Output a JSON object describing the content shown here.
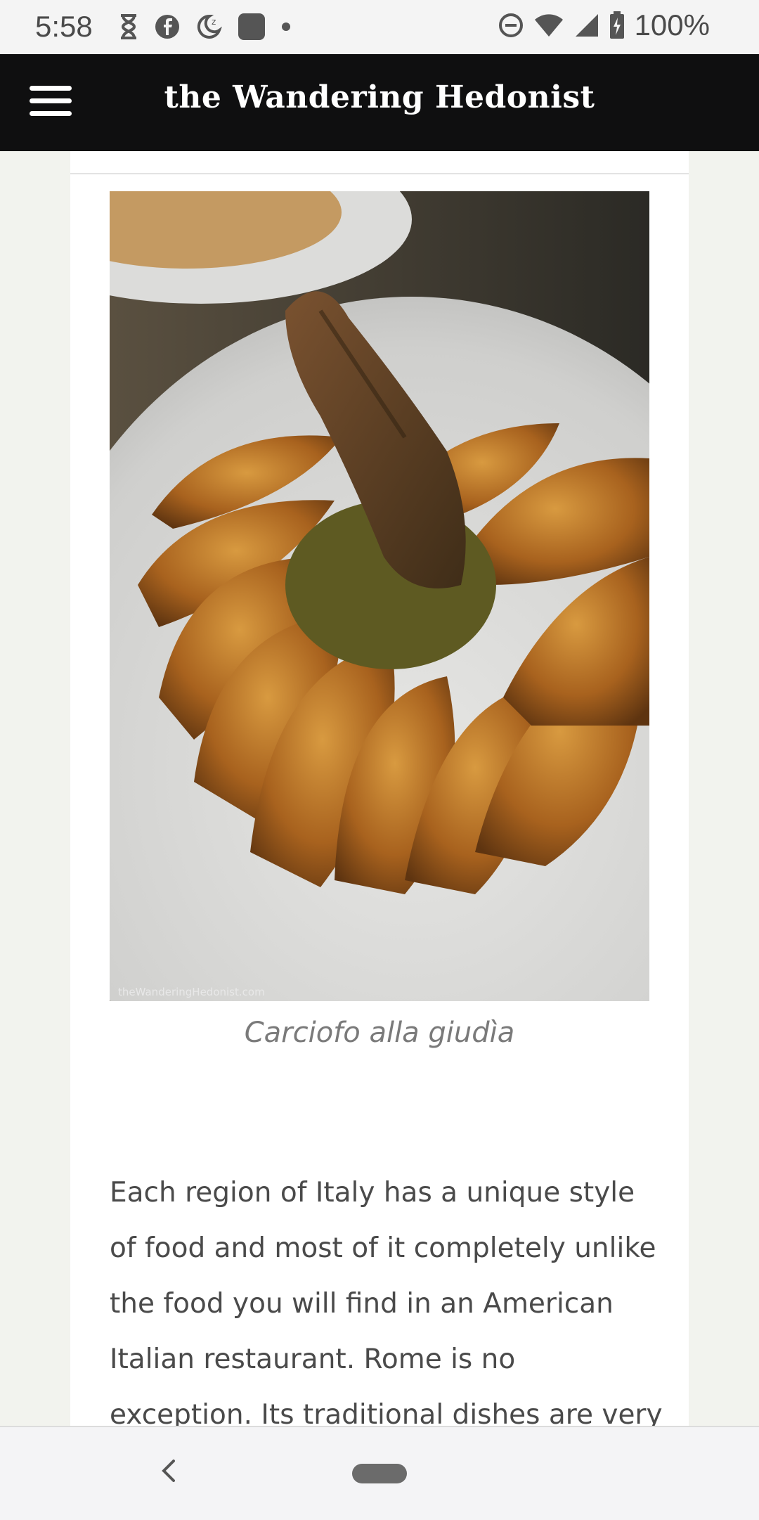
{
  "status_bar": {
    "time": "5:58",
    "battery": "100%",
    "left_icons": [
      "hourglass-icon",
      "facebook-icon",
      "do-not-disturb-moon-icon",
      "app-square-icon",
      "dot-icon"
    ],
    "right_icons": [
      "minus-circle-icon",
      "wifi-icon",
      "signal-icon",
      "battery-icon"
    ]
  },
  "header": {
    "site_title": "the Wandering Hedonist",
    "menu_icon": "hamburger-menu-icon"
  },
  "article": {
    "image_watermark": "theWanderingHedonist.com",
    "caption": "Carciofo alla giudìa",
    "paragraph": "Each region of Italy has a unique style of food and most of it completely unlike the food you will find in an American Italian restaurant. Rome is no exception. Its traditional dishes are very"
  },
  "nav_bar": {
    "back_icon": "chevron-left-icon",
    "home_icon": "home-pill-icon"
  },
  "colors": {
    "header_bg": "#0f0f10",
    "page_bg": "#f2f3ee",
    "text": "#4a4a4a",
    "caption": "#7a7a7a"
  }
}
